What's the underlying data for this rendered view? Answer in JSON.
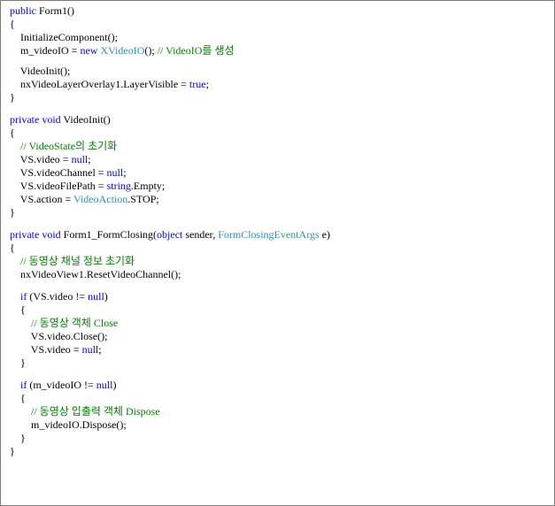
{
  "editor": {
    "lines": [
      [
        {
          "t": "public",
          "k": "keyword"
        },
        {
          "t": " Form1()"
        }
      ],
      [
        {
          "t": "{"
        }
      ],
      [
        {
          "t": "    InitializeComponent();"
        }
      ],
      [
        {
          "t": "    m_videoIO = "
        },
        {
          "t": "new",
          "k": "keyword"
        },
        {
          "t": " "
        },
        {
          "t": "XVideoIO",
          "k": "type"
        },
        {
          "t": "(); "
        },
        {
          "t": "// VideoIO를 생성",
          "k": "comment"
        }
      ],
      {
        "gap": "sm"
      },
      [
        {
          "t": "    VideoInit();"
        }
      ],
      [
        {
          "t": "    nxVideoLayerOverlay1.LayerVisible = "
        },
        {
          "t": "true",
          "k": "keyword"
        },
        {
          "t": ";"
        }
      ],
      [
        {
          "t": "}"
        }
      ],
      {
        "gap": "lg"
      },
      [
        {
          "t": "private",
          "k": "keyword"
        },
        {
          "t": " "
        },
        {
          "t": "void",
          "k": "keyword"
        },
        {
          "t": " VideoInit()"
        }
      ],
      [
        {
          "t": "{"
        }
      ],
      [
        {
          "t": "    "
        },
        {
          "t": "// VideoState의 초기화",
          "k": "comment"
        }
      ],
      [
        {
          "t": "    VS.video = "
        },
        {
          "t": "null",
          "k": "keyword"
        },
        {
          "t": ";"
        }
      ],
      [
        {
          "t": "    VS.videoChannel = "
        },
        {
          "t": "null",
          "k": "keyword"
        },
        {
          "t": ";"
        }
      ],
      [
        {
          "t": "    VS.videoFilePath = "
        },
        {
          "t": "string",
          "k": "keyword"
        },
        {
          "t": ".Empty;"
        }
      ],
      [
        {
          "t": "    VS.action = "
        },
        {
          "t": "VideoAction",
          "k": "type"
        },
        {
          "t": ".STOP;"
        }
      ],
      [
        {
          "t": "}"
        }
      ],
      {
        "gap": "lg"
      },
      [
        {
          "t": "private",
          "k": "keyword"
        },
        {
          "t": " "
        },
        {
          "t": "void",
          "k": "keyword"
        },
        {
          "t": " Form1_FormClosing("
        },
        {
          "t": "object",
          "k": "keyword"
        },
        {
          "t": " sender, "
        },
        {
          "t": "FormClosingEventArgs",
          "k": "type"
        },
        {
          "t": " e)"
        }
      ],
      [
        {
          "t": "{"
        }
      ],
      [
        {
          "t": "    "
        },
        {
          "t": "// 동영상 채널 정보 초기화",
          "k": "comment"
        }
      ],
      [
        {
          "t": "    nxVideoView1.ResetVideoChannel();"
        }
      ],
      {
        "gap": "lg"
      },
      [
        {
          "t": "    "
        },
        {
          "t": "if",
          "k": "keyword"
        },
        {
          "t": " (VS.video != "
        },
        {
          "t": "null",
          "k": "keyword"
        },
        {
          "t": ")"
        }
      ],
      [
        {
          "t": "    {"
        }
      ],
      [
        {
          "t": "        "
        },
        {
          "t": "// 동영상 객체 Close",
          "k": "comment"
        }
      ],
      [
        {
          "t": "        VS.video.Close();"
        }
      ],
      [
        {
          "t": "        VS.video = "
        },
        {
          "t": "null",
          "k": "keyword"
        },
        {
          "t": ";"
        }
      ],
      [
        {
          "t": "    }"
        }
      ],
      {
        "gap": "lg"
      },
      [
        {
          "t": "    "
        },
        {
          "t": "if",
          "k": "keyword"
        },
        {
          "t": " (m_videoIO != "
        },
        {
          "t": "null",
          "k": "keyword"
        },
        {
          "t": ")"
        }
      ],
      [
        {
          "t": "    {"
        }
      ],
      [
        {
          "t": "        "
        },
        {
          "t": "// 동영상 입출력 객체 Dispose",
          "k": "comment"
        }
      ],
      [
        {
          "t": "        m_videoIO.Dispose();"
        }
      ],
      [
        {
          "t": "    }"
        }
      ],
      [
        {
          "t": "}"
        }
      ]
    ]
  },
  "colors": {
    "keyword": "#0000ff",
    "type": "#2b91af",
    "comment": "#008000",
    "text": "#000000",
    "border": "#7a7a7a",
    "background": "#ffffff"
  }
}
